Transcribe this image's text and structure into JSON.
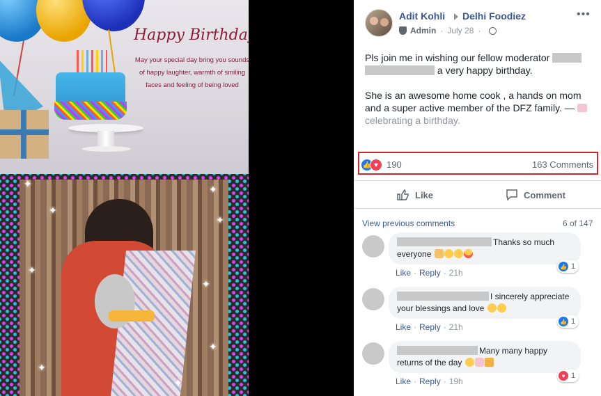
{
  "media": {
    "greeting_title": "Happy Birthday!",
    "greeting_text": "May your special day bring you sounds of happy laughter, warmth of smiling faces and feeling of being loved"
  },
  "post": {
    "author": "Adit Kohli",
    "group": "Delhi Foodiez",
    "role": "Admin",
    "date": "July 28",
    "paragraph1_start": "Pls join me in wishing our fellow moderator",
    "paragraph1_end": "a very happy birthday.",
    "paragraph2": "She is an awesome home cook , a hands on mom and a super active member of the DFZ family. —",
    "feeling": "celebrating a birthday."
  },
  "engagement": {
    "reaction_count": "190",
    "comments_count": "163 Comments",
    "like_label": "Like",
    "comment_label": "Comment"
  },
  "comments_section": {
    "view_previous": "View previous comments",
    "pagination": "6 of 147",
    "items": [
      {
        "text": "Thanks so much everyone",
        "like_label": "Like",
        "reply_label": "Reply",
        "time": "21h",
        "reaction_type": "like",
        "reaction_count": "1"
      },
      {
        "text": "I sincerely appreciate your blessings and love",
        "like_label": "Like",
        "reply_label": "Reply",
        "time": "21h",
        "reaction_type": "like",
        "reaction_count": "1"
      },
      {
        "text": "Many many happy returns of the day",
        "like_label": "Like",
        "reply_label": "Reply",
        "time": "19h",
        "reaction_type": "love",
        "reaction_count": "1"
      }
    ]
  },
  "icons": {
    "more": "more-dots-icon",
    "admin": "shield-icon",
    "privacy": "globe-icon",
    "group_arrow": "triangle-right-icon"
  },
  "colors": {
    "link_blue": "#385898",
    "highlight_red": "#d0262c",
    "like_blue": "#1877f2",
    "love_red": "#f33e58"
  }
}
